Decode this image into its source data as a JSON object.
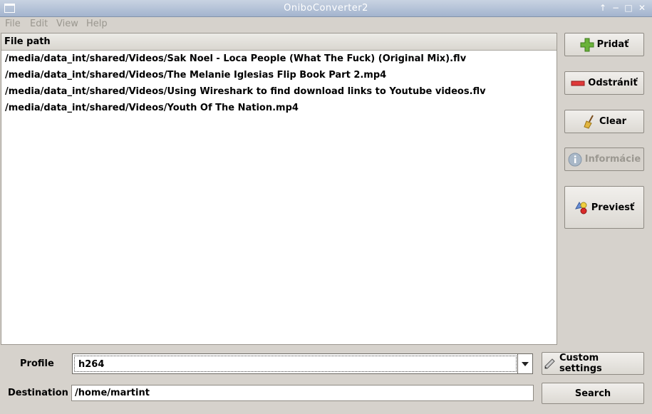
{
  "window": {
    "title": "OniboConverter2",
    "controls": [
      "up-arrow-icon",
      "restore-icon",
      "close-icon"
    ]
  },
  "menubar": {
    "items": [
      "File",
      "Edit",
      "View",
      "Help"
    ]
  },
  "file_list": {
    "header": "File path",
    "rows": [
      "/media/data_int/shared/Videos/Sak Noel - Loca People (What The Fuck) (Original Mix).flv",
      "/media/data_int/shared/Videos/The Melanie Iglesias Flip Book Part 2.mp4",
      "/media/data_int/shared/Videos/Using Wireshark to find download links to Youtube videos.flv",
      "/media/data_int/shared/Videos/Youth Of The Nation.mp4"
    ]
  },
  "side_buttons": {
    "add": "Pridať",
    "remove": "Odstrániť",
    "clear": "Clear",
    "info": "Informácie",
    "convert": "Previesť"
  },
  "profile": {
    "label": "Profile",
    "value": "h264",
    "custom_settings": "Custom settings"
  },
  "destination": {
    "label": "Destination",
    "value": "/home/martint",
    "search": "Search"
  }
}
